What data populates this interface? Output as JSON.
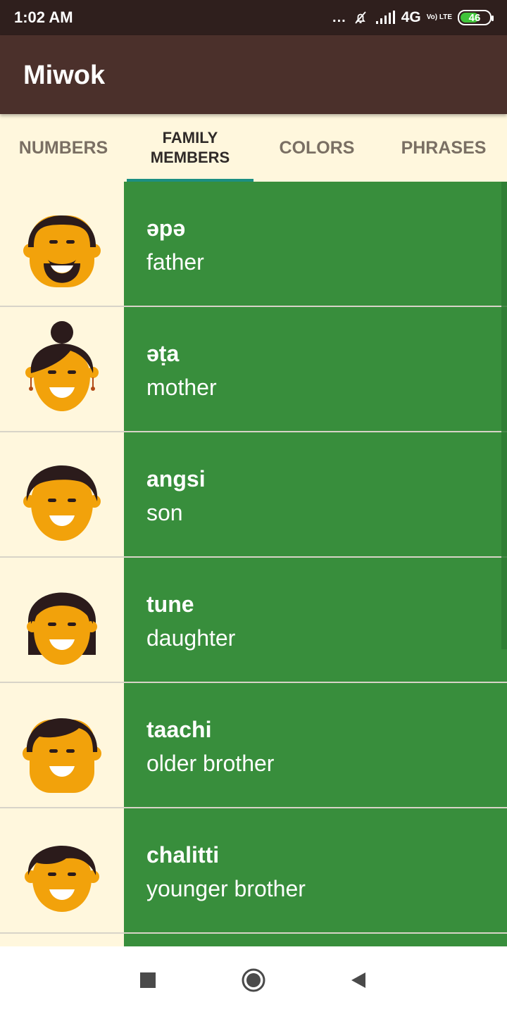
{
  "status_bar": {
    "time": "1:02 AM",
    "signal_dots": "...",
    "network": "4G",
    "volte": "Vo) LTE",
    "battery": "46",
    "colors": {
      "background": "#2f1f1d",
      "battery_fill": "#40c43a"
    }
  },
  "app_bar": {
    "title": "Miwok",
    "background": "#4b302b"
  },
  "tabs": [
    {
      "label": "NUMBERS",
      "active": false
    },
    {
      "label": "FAMILY\nMEMBERS",
      "active": true
    },
    {
      "label": "COLORS",
      "active": false
    },
    {
      "label": "PHRASES",
      "active": false
    }
  ],
  "family_list": {
    "accent_color": "#388e3c",
    "items": [
      {
        "miwok": "əpə",
        "english": "father",
        "icon": "father-icon"
      },
      {
        "miwok": "əṭa",
        "english": "mother",
        "icon": "mother-icon"
      },
      {
        "miwok": "angsi",
        "english": "son",
        "icon": "son-icon"
      },
      {
        "miwok": "tune",
        "english": "daughter",
        "icon": "daughter-icon"
      },
      {
        "miwok": "taachi",
        "english": "older brother",
        "icon": "older-brother-icon"
      },
      {
        "miwok": "chalitti",
        "english": "younger brother",
        "icon": "younger-brother-icon"
      }
    ]
  },
  "navigation_bar": {
    "buttons": [
      {
        "icon": "square-recent-apps-icon"
      },
      {
        "icon": "circle-home-icon"
      },
      {
        "icon": "triangle-back-icon"
      }
    ]
  }
}
